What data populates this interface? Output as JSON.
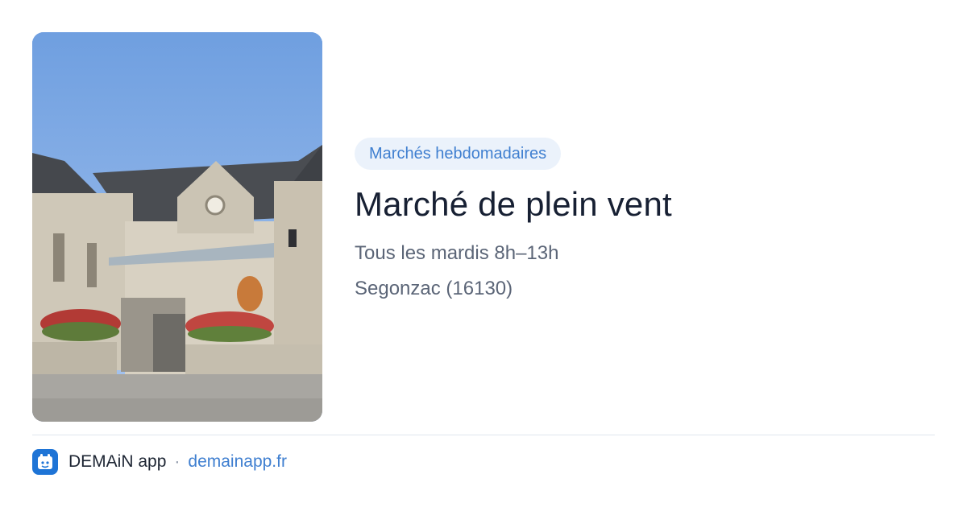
{
  "image": {
    "subject": "market-hall-photo"
  },
  "category_tag": "Marchés hebdomadaires",
  "title": "Marché de plein vent",
  "schedule": "Tous les mardis 8h–13h",
  "location": "Segonzac (16130)",
  "footer": {
    "app_name": "DEMAiN app",
    "separator": "·",
    "website": "demainapp.fr",
    "logo_icon": "demain-logo-icon"
  },
  "colors": {
    "accent": "#3f7fd0",
    "tag_bg": "#ebf2fb",
    "title": "#172033",
    "meta": "#5b6577",
    "logo_bg": "#1e74d6"
  }
}
